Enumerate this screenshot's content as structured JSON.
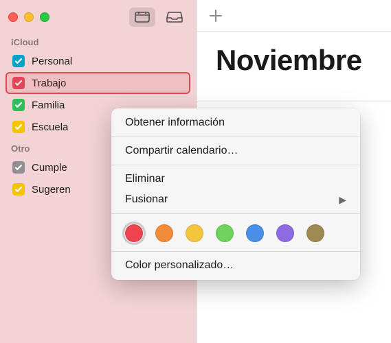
{
  "header": {
    "month": "Noviembre"
  },
  "sidebar": {
    "sections": [
      {
        "title": "iCloud",
        "items": [
          {
            "label": "Personal",
            "color": "#00a3c7",
            "checked": true,
            "selected": false
          },
          {
            "label": "Trabajo",
            "color": "#e6445b",
            "checked": true,
            "selected": true
          },
          {
            "label": "Familia",
            "color": "#2fbf5a",
            "checked": true,
            "selected": false
          },
          {
            "label": "Escuela",
            "color": "#f5c400",
            "checked": true,
            "selected": false
          }
        ]
      },
      {
        "title": "Otro",
        "items": [
          {
            "label": "Cumple",
            "color": "#8f8f94",
            "checked": true,
            "selected": false
          },
          {
            "label": "Sugeren",
            "color": "#f5c400",
            "checked": true,
            "selected": false
          }
        ]
      }
    ]
  },
  "context_menu": {
    "get_info": "Obtener información",
    "share": "Compartir calendario…",
    "delete": "Eliminar",
    "merge": "Fusionar",
    "colors": [
      {
        "name": "red",
        "hex": "#ee4450",
        "selected": true
      },
      {
        "name": "orange",
        "hex": "#f08b3a",
        "selected": false
      },
      {
        "name": "yellow",
        "hex": "#f3c63e",
        "selected": false
      },
      {
        "name": "green",
        "hex": "#6fd35c",
        "selected": false
      },
      {
        "name": "blue",
        "hex": "#4a8fe7",
        "selected": false
      },
      {
        "name": "purple",
        "hex": "#8e6be0",
        "selected": false
      },
      {
        "name": "brown",
        "hex": "#a08a53",
        "selected": false
      }
    ],
    "custom_color": "Color personalizado…"
  }
}
